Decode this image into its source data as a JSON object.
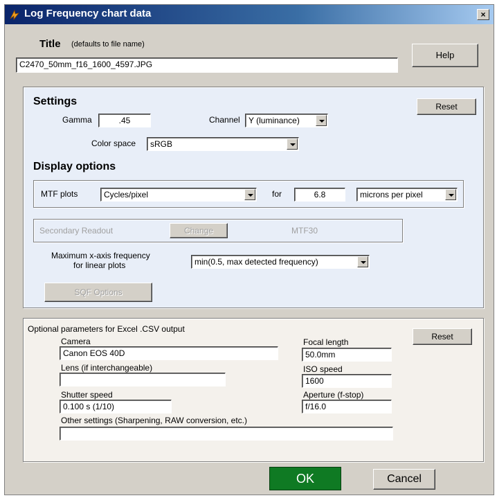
{
  "window": {
    "title": "Log Frequency chart data",
    "close_label": "×"
  },
  "title_section": {
    "label": "Title",
    "hint": "(defaults to file name)",
    "value": "C2470_50mm_f16_1600_4597.JPG",
    "help_label": "Help"
  },
  "settings": {
    "heading": "Settings",
    "reset_label": "Reset",
    "gamma_label": "Gamma",
    "gamma_value": ".45",
    "channel_label": "Channel",
    "channel_value": "Y (luminance)",
    "colorspace_label": "Color space",
    "colorspace_value": "sRGB"
  },
  "display": {
    "heading": "Display options",
    "mtf_label": "MTF plots",
    "mtf_value": "Cycles/pixel",
    "for_label": "for",
    "pixel_size_value": "6.8",
    "pixel_units_value": "microns per pixel",
    "secondary_label": "Secondary Readout",
    "change_label": "Change",
    "secondary_value": "MTF30",
    "max_freq_label_line1": "Maximum x-axis frequency",
    "max_freq_label_line2": "for linear plots",
    "max_freq_value": "min(0.5, max detected frequency)",
    "sqf_label": "SQF Options"
  },
  "params": {
    "heading": "Optional parameters  for Excel .CSV output",
    "reset_label": "Reset",
    "camera_label": "Camera",
    "camera_value": "Canon EOS 40D",
    "lens_label": "Lens (if interchangeable)",
    "lens_value": "",
    "shutter_label": "Shutter speed",
    "shutter_value": "0.100 s  (1/10)",
    "focal_label": "Focal length",
    "focal_value": "50.0mm",
    "iso_label": "ISO speed",
    "iso_value": "1600",
    "aperture_label": "Aperture (f-stop)",
    "aperture_value": "f/16.0",
    "other_label": "Other settings (Sharpening, RAW conversion, etc.)",
    "other_value": ""
  },
  "footer": {
    "ok_label": "OK",
    "cancel_label": "Cancel"
  },
  "colors": {
    "titlebar": "#0a246a",
    "ok_button": "#0f7a23",
    "settings_bg": "#e8eef8"
  }
}
